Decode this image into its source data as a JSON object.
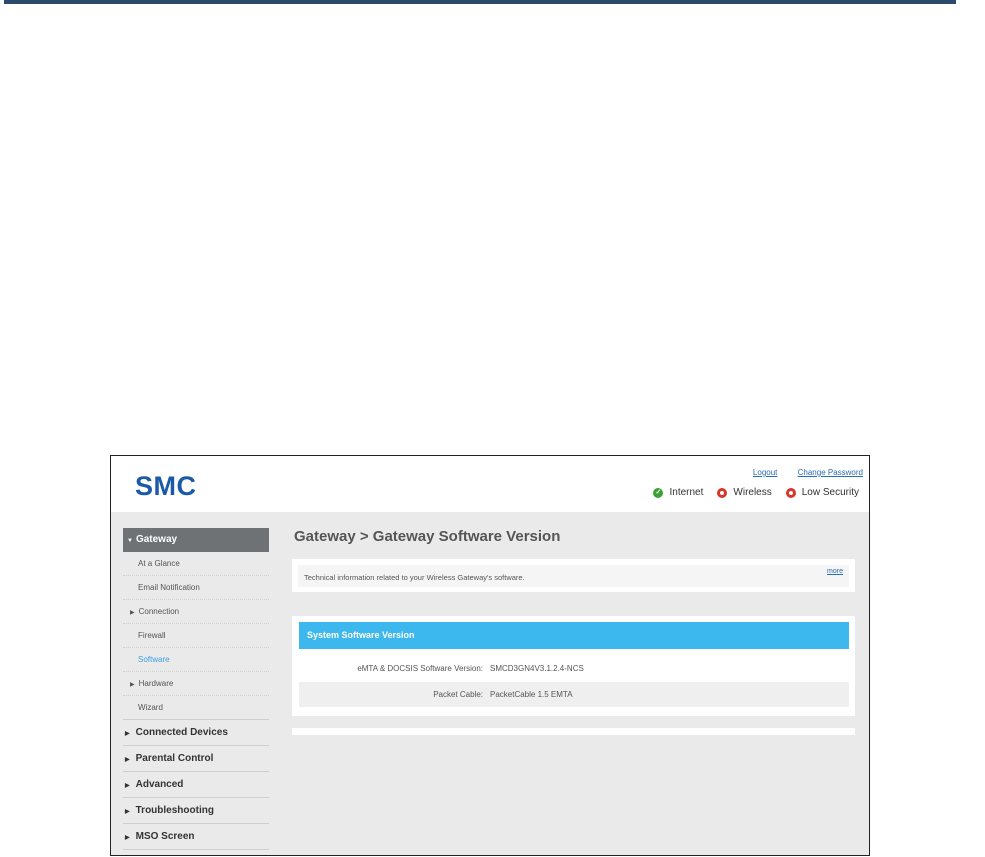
{
  "header": {
    "logo": "SMC",
    "links": {
      "logout": "Logout",
      "change_password": "Change Password"
    },
    "status": [
      {
        "label": "Internet",
        "icon": "check-circle-icon",
        "color": "#3aa335"
      },
      {
        "label": "Wireless",
        "icon": "warning-ring-icon",
        "color": "#d9362b"
      },
      {
        "label": "Low Security",
        "icon": "warning-ring-icon",
        "color": "#d9362b"
      }
    ]
  },
  "sidebar": {
    "section": "Gateway",
    "sub_items": [
      {
        "label": "At a Glance"
      },
      {
        "label": "Email Notification"
      },
      {
        "label": "Connection"
      },
      {
        "label": "Firewall"
      },
      {
        "label": "Software"
      },
      {
        "label": "Hardware"
      },
      {
        "label": "Wizard"
      }
    ],
    "main_items": [
      {
        "label": "Connected Devices"
      },
      {
        "label": "Parental Control"
      },
      {
        "label": "Advanced"
      },
      {
        "label": "Troubleshooting"
      },
      {
        "label": "MSO Screen"
      }
    ]
  },
  "main": {
    "title": "Gateway > Gateway Software Version",
    "info_text": "Technical information related to your Wireless Gateway's software.",
    "more_link": "more",
    "table": {
      "heading": "System Software Version",
      "rows": [
        {
          "label": "eMTA & DOCSIS Software Version:",
          "value": "SMCD3GN4V3.1.2.4-NCS"
        },
        {
          "label": "Packet Cable:",
          "value": "PacketCable 1.5 EMTA"
        }
      ]
    }
  },
  "colors": {
    "accent": "#3db8ee",
    "brand": "#1a5aa8",
    "nav_header": "#6f7275"
  }
}
